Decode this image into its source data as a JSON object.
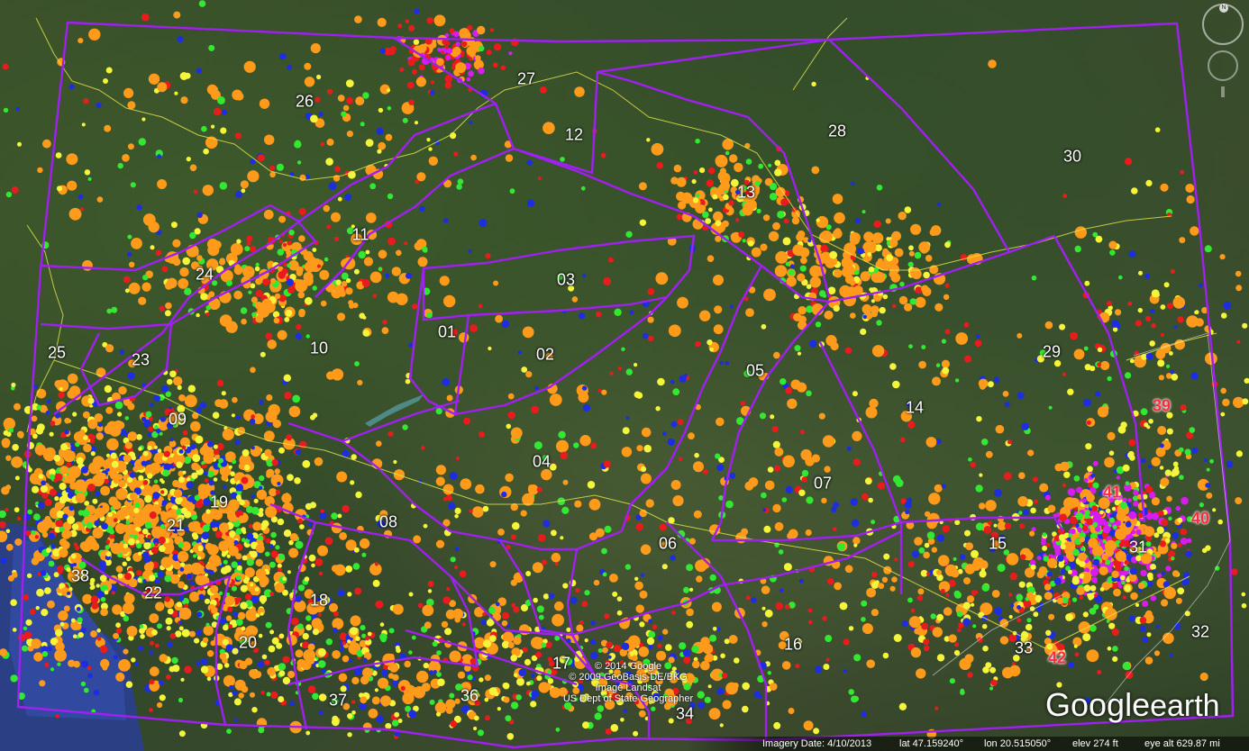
{
  "zone_labels": [
    {
      "text": "26"
    },
    {
      "text": "27"
    },
    {
      "text": "12"
    },
    {
      "text": "28"
    },
    {
      "text": "30"
    },
    {
      "text": "13"
    },
    {
      "text": "11"
    },
    {
      "text": "24"
    },
    {
      "text": "03"
    },
    {
      "text": "01"
    },
    {
      "text": "02"
    },
    {
      "text": "25"
    },
    {
      "text": "23"
    },
    {
      "text": "10"
    },
    {
      "text": "05"
    },
    {
      "text": "29"
    },
    {
      "text": "14"
    },
    {
      "text": "39",
      "alert": true
    },
    {
      "text": "09"
    },
    {
      "text": "04"
    },
    {
      "text": "07"
    },
    {
      "text": "41",
      "alert": true
    },
    {
      "text": "40",
      "alert": true
    },
    {
      "text": "19"
    },
    {
      "text": "21"
    },
    {
      "text": "08"
    },
    {
      "text": "06"
    },
    {
      "text": "15"
    },
    {
      "text": "31"
    },
    {
      "text": "38"
    },
    {
      "text": "22"
    },
    {
      "text": "18"
    },
    {
      "text": "20"
    },
    {
      "text": "16"
    },
    {
      "text": "33"
    },
    {
      "text": "42",
      "alert": true
    },
    {
      "text": "32"
    },
    {
      "text": "17"
    },
    {
      "text": "37"
    },
    {
      "text": "36"
    },
    {
      "text": "34"
    }
  ],
  "copyright": {
    "line1": "© 2014 Google",
    "line2": "© 2009 GeoBasis-DE/BKG",
    "line3": "Image Landsat",
    "line4": "US Dept of State Geographer"
  },
  "brand": {
    "google": "Google",
    "earth": "earth"
  },
  "status": {
    "imagery_date": "Imagery Date: 4/10/2013",
    "lat": "lat   47.159240°",
    "lon": "lon   20.515050°",
    "elev": "elev   274 ft",
    "eye_alt": "eye alt 629.87 mi"
  },
  "compass": {
    "north_letter": "N"
  },
  "colors": {
    "zone_border": "#a020f0",
    "country_border": "#e8e84a",
    "sea": "#2a3e8f",
    "event_orange": "#ff9a1a",
    "event_yellow": "#f4f43a",
    "event_red": "#e81c1c",
    "event_green": "#33e833",
    "event_blue": "#1c2ee0",
    "event_magenta": "#d61cf0",
    "alert_label": "#ff2a3c"
  }
}
